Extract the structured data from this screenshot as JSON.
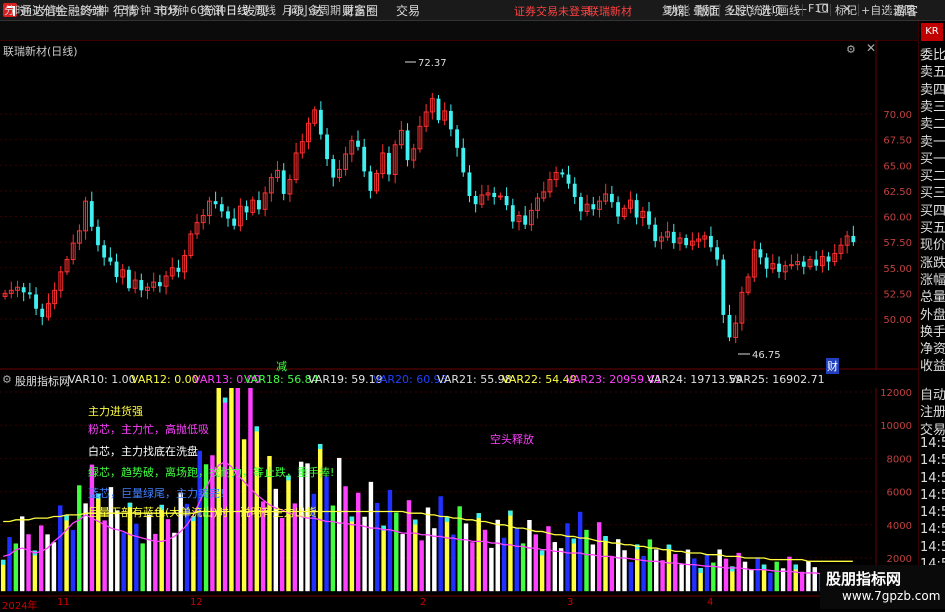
{
  "titlebar": {
    "app_title": "通达信金融终端",
    "menu": [
      "行情",
      "市场",
      "资讯",
      "发现",
      "问小达",
      "财富圈",
      "交易"
    ],
    "login_warning": "证券交易未登录",
    "news_link": "联瑞新材",
    "right_menu": [
      "功能",
      "版面",
      "公式",
      "选项"
    ],
    "guest": "游客"
  },
  "periods": [
    "分时",
    "1分钟",
    "5分钟",
    "15分钟",
    "30分钟",
    "60分钟",
    "日线",
    "周线",
    "月线",
    "多周期",
    "更多"
  ],
  "active_period": "日线",
  "tools": [
    "复权",
    "叠加",
    "多股",
    "统计",
    "画线",
    "F10",
    "标记",
    "+自选",
    "返回"
  ],
  "kline": {
    "title": "联瑞新材(日线)",
    "high_label": "72.37",
    "low_label": "46.75",
    "marker_green": "减",
    "marker_blue": "财",
    "y_ticks": [
      "70.00",
      "67.50",
      "65.00",
      "62.50",
      "60.00",
      "57.50",
      "55.00",
      "52.50",
      "50.00"
    ]
  },
  "indicator": {
    "name": "股朋指标网",
    "vars": [
      {
        "label": "VAR10: 1.00",
        "color": "#e0e0e0"
      },
      {
        "label": "VAR12: 0.00",
        "color": "#ffff40"
      },
      {
        "label": "VAR13: 0.00",
        "color": "#ff40ff"
      },
      {
        "label": "VAR18: 56.84",
        "color": "#40ff40"
      },
      {
        "label": "VAR19: 59.19",
        "color": "#e0e0e0"
      },
      {
        "label": "VAR20: 60.93",
        "color": "#2040ff"
      },
      {
        "label": "VAR21: 55.98",
        "color": "#e0e0e0"
      },
      {
        "label": "VAR22: 54.49",
        "color": "#ffff40"
      },
      {
        "label": "VAR23: 20959.41",
        "color": "#ff40ff"
      },
      {
        "label": "VAR24: 19713.59",
        "color": "#e0e0e0"
      },
      {
        "label": "VAR25: 16902.71",
        "color": "#e0e0e0"
      }
    ],
    "legend": [
      {
        "text": "主力进货强",
        "color": "#ffff40"
      },
      {
        "text": "粉芯，主力忙，高抛低吸",
        "color": "#ff40ff"
      },
      {
        "text": "白芯，主力找底在洗盘",
        "color": "#ffffff"
      },
      {
        "text": "绿芯，趋势破，离场跑，找耐力，等止跌，重手捧!",
        "color": "#40ff40"
      },
      {
        "text": "蓝芯，巨量绿尾，主力卖完!",
        "color": "#4080ff"
      },
      {
        "text": "巨量下部有蓝色(大单流出)时，说明有主力出货",
        "color": "#ffff40"
      }
    ],
    "annotation": "空头释放",
    "y_ticks": [
      "12000",
      "10000",
      "8000",
      "6000",
      "4000",
      "2000"
    ]
  },
  "sidebar_top": [
    "委比",
    "卖五",
    "卖四",
    "卖三",
    "卖二",
    "卖一",
    "买一",
    "买二",
    "买三",
    "买四",
    "买五",
    "现价",
    "涨跌",
    "涨幅",
    "总量",
    "外盘",
    "换手",
    "净资",
    "收益"
  ],
  "sidebar_bottom": [
    "自动",
    "注册",
    "交易",
    "14:5",
    "14:5",
    "14:5",
    "14:5",
    "14:5",
    "14:5",
    "14:5",
    "14:5"
  ],
  "sidebar_badge": "KR",
  "date_axis": {
    "year": "2024年",
    "months": [
      "11",
      "12",
      "2",
      "3",
      "4"
    ]
  },
  "watermark": {
    "line1": "股朋指标网",
    "line2": "www.7gpzb.com"
  },
  "colors": {
    "up": "#ff3030",
    "down": "#40f0f0",
    "yellow": "#ffff40",
    "magenta": "#ff40ff",
    "blue": "#2030ff",
    "grid": "#3a0000",
    "axis": "#c04040"
  },
  "chart_data": [
    {
      "type": "candlestick",
      "title": "联瑞新材(日线)",
      "ylim": [
        47.5,
        72.5
      ],
      "y_ticks": [
        50.0,
        52.5,
        55.0,
        57.5,
        60.0,
        62.5,
        65.0,
        67.5,
        70.0
      ],
      "annotations": [
        {
          "text": "72.37",
          "role": "high"
        },
        {
          "text": "46.75",
          "role": "low"
        }
      ],
      "close_series": [
        52.5,
        52.8,
        53.1,
        52.6,
        52.4,
        51.0,
        50.2,
        51.5,
        52.8,
        54.6,
        55.8,
        57.4,
        58.6,
        61.5,
        59.0,
        57.2,
        56.0,
        55.6,
        54.1,
        54.8,
        53.0,
        53.8,
        52.8,
        53.1,
        53.6,
        53.2,
        54.2,
        55.0,
        54.6,
        56.2,
        58.3,
        59.4,
        60.1,
        61.5,
        61.2,
        60.5,
        59.8,
        59.1,
        61.0,
        60.4,
        61.6,
        60.7,
        62.3,
        63.8,
        64.5,
        62.2,
        63.6,
        66.2,
        67.3,
        69.1,
        70.4,
        68.0,
        65.6,
        63.8,
        64.6,
        66.1,
        67.4,
        66.8,
        64.4,
        62.5,
        64.2,
        66.2,
        64.1,
        67.0,
        68.4,
        65.5,
        66.6,
        68.8,
        70.2,
        71.5,
        69.4,
        70.3,
        68.5,
        66.7,
        64.3,
        62.0,
        61.2,
        62.1,
        62.3,
        61.9,
        62.0,
        61.1,
        59.5,
        60.1,
        59.2,
        60.6,
        61.8,
        62.4,
        63.6,
        64.3,
        64.1,
        63.2,
        61.9,
        60.5,
        61.2,
        60.7,
        61.5,
        62.2,
        61.4,
        60.0,
        60.8,
        61.6,
        59.9,
        60.5,
        59.2,
        57.6,
        58.0,
        58.5,
        57.4,
        57.9,
        57.2,
        57.6,
        57.8,
        58.1,
        57.0,
        55.8,
        50.4,
        48.2,
        49.6,
        52.6,
        54.1,
        56.8,
        56.0,
        54.9,
        55.4,
        54.6,
        55.2,
        55.3,
        55.6,
        55.1,
        55.8,
        55.2,
        56.1,
        55.6,
        56.4,
        57.2,
        58.1,
        57.5
      ]
    },
    {
      "type": "bar",
      "title": "股朋指标网",
      "ylim": [
        0,
        13000
      ],
      "y_ticks": [
        2000,
        4000,
        6000,
        8000,
        10000,
        12000
      ],
      "series": [
        {
          "name": "VAR23",
          "values": [
            2100,
            2200,
            2500,
            2600,
            2450,
            2300,
            2400,
            2600,
            3000,
            3300,
            3700,
            4100,
            4300,
            4600,
            4400,
            4200,
            4000,
            3800,
            3700,
            3600,
            3400,
            3300,
            3200,
            3100,
            3000,
            3000,
            3100,
            3300,
            3600,
            4000,
            4600,
            5400,
            6200,
            7000,
            7600,
            7800,
            7500,
            7000,
            6600,
            6200,
            5800,
            5500,
            5200,
            5000,
            4900,
            4700,
            4600,
            4500,
            4400,
            4400,
            4300,
            4200,
            4200,
            4100,
            4100,
            4000,
            4000,
            3900,
            3800,
            3800,
            3700,
            3700,
            3600,
            3500,
            3500,
            3500,
            3400,
            3400,
            3300,
            3300,
            3200,
            3200,
            3100,
            3100,
            3000,
            3000,
            3000,
            2900,
            2900,
            2800,
            2800,
            2700,
            2700,
            2600,
            2600,
            2500,
            2500,
            2400,
            2400,
            2300,
            2300,
            2300,
            2200,
            2200,
            2100,
            2100,
            2100,
            2000,
            2000,
            1950,
            1900,
            1850,
            1800,
            1800,
            1750,
            1700,
            1700,
            1650,
            1600,
            1600,
            1550,
            1500,
            1500,
            1450,
            1400,
            1400,
            1400,
            1350,
            1300,
            1300,
            1300,
            1250,
            1200,
            1200,
            1200,
            1150,
            1100,
            1100,
            1100,
            1050,
            1000,
            1000,
            1000,
            1000,
            1000
          ]
        },
        {
          "name": "VAR24",
          "values": [
            4200,
            4200,
            4300,
            4300,
            4300,
            4400,
            4400,
            4400,
            4500,
            4500,
            4600,
            4600,
            4600,
            4700,
            4700,
            4700,
            4700,
            4700,
            4700,
            4700,
            4700,
            4700,
            4700,
            4700,
            4700,
            4700,
            4700,
            4700,
            4700,
            4700,
            4700,
            4800,
            4800,
            4800,
            4800,
            4800,
            4800,
            4800,
            4800,
            4800,
            4800,
            4800,
            4800,
            4800,
            4800,
            4800,
            4800,
            4800,
            4800,
            4800,
            4800,
            4800,
            4800,
            4800,
            4800,
            4800,
            4800,
            4800,
            4800,
            4800,
            4800,
            4800,
            4800,
            4800,
            4700,
            4700,
            4700,
            4600,
            4600,
            4500,
            4500,
            4400,
            4400,
            4300,
            4300,
            4200,
            4200,
            4100,
            4000,
            4000,
            3900,
            3800,
            3800,
            3700,
            3600,
            3600,
            3500,
            3400,
            3400,
            3300,
            3300,
            3200,
            3200,
            3100,
            3000,
            3000,
            2900,
            2900,
            2800,
            2800,
            2700,
            2700,
            2600,
            2600,
            2500,
            2500,
            2400,
            2400,
            2300,
            2300,
            2300,
            2200,
            2200,
            2200,
            2100,
            2100,
            2100,
            2000,
            2000,
            2000,
            2000,
            1900,
            1900,
            1900,
            1900,
            1900,
            1900,
            1800,
            1800,
            1800,
            1800,
            1800,
            1800,
            1800,
            1800
          ]
        }
      ]
    }
  ]
}
